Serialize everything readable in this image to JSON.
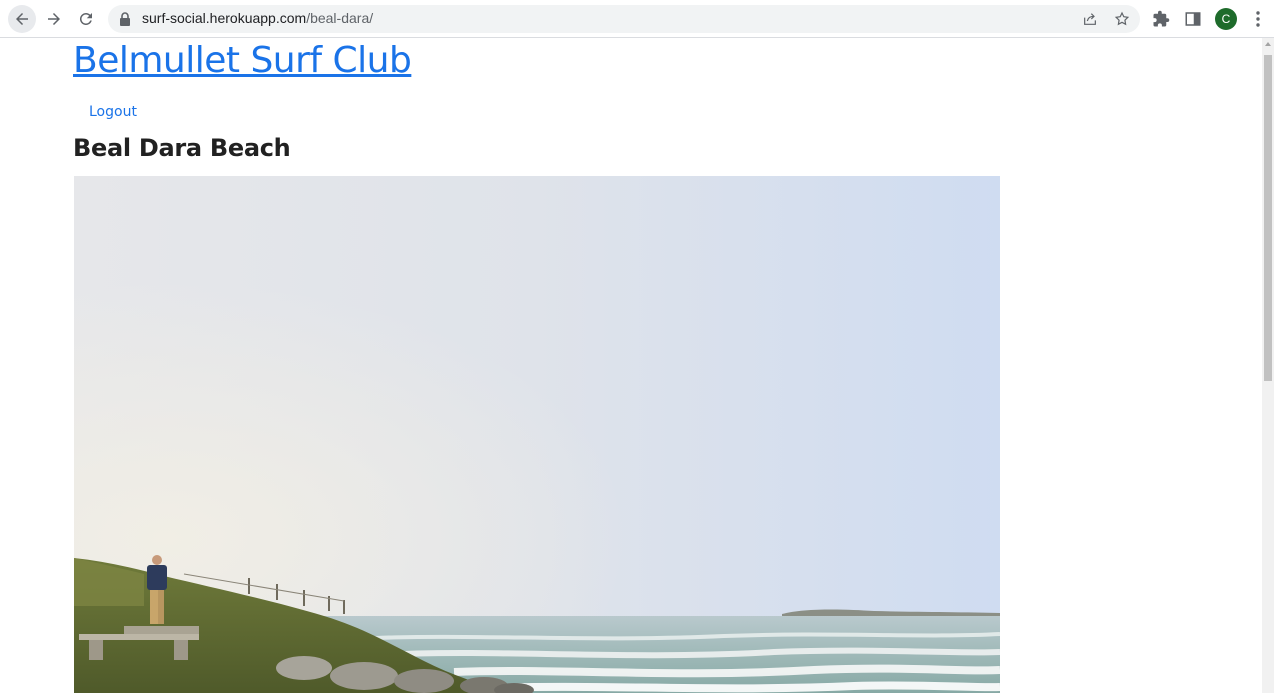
{
  "browser": {
    "url_host": "surf-social.herokuapp.com",
    "url_path": "/beal-dara/",
    "profile_initial": "C"
  },
  "site": {
    "title": "Belmullet Surf Club",
    "nav": {
      "logout_label": "Logout"
    }
  },
  "beach": {
    "name": "Beal Dara Beach"
  },
  "colors": {
    "link": "#1a73e8",
    "avatar": "#1e6b2b"
  }
}
